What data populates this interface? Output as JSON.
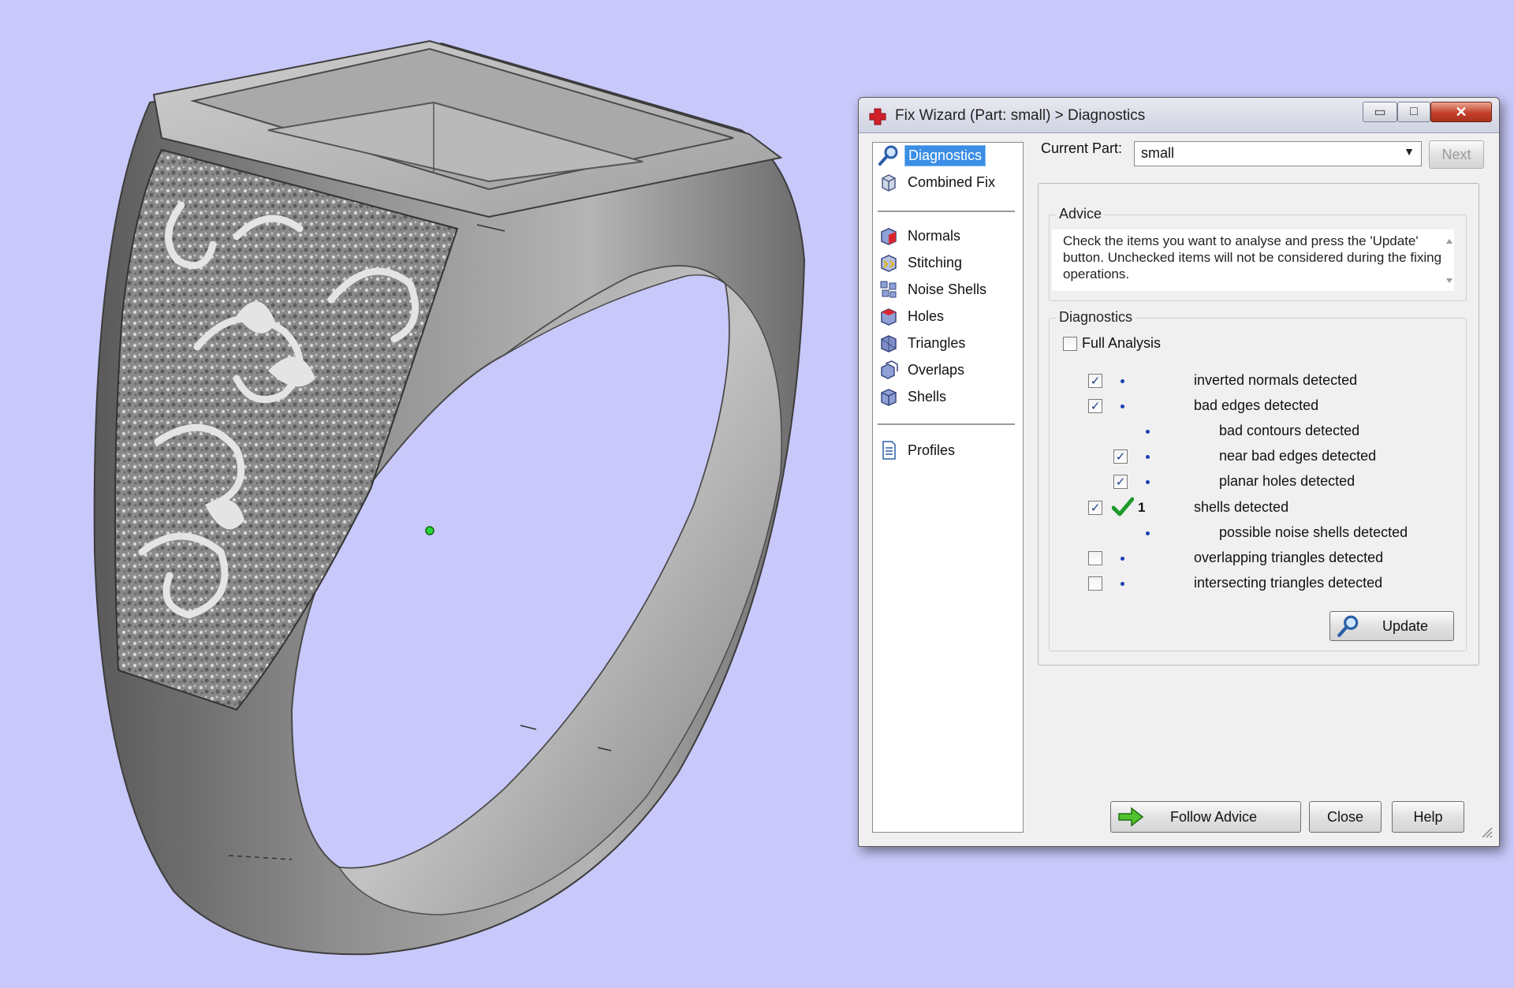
{
  "dialog": {
    "title": "Fix Wizard (Part: small) > Diagnostics",
    "window_buttons": {
      "minimize": "▭",
      "maximize": "□",
      "close": "✕"
    }
  },
  "nav": {
    "items_top": [
      {
        "label": "Diagnostics",
        "icon": "magnifier-icon",
        "selected": true
      },
      {
        "label": "Combined Fix",
        "icon": "cubes-icon"
      }
    ],
    "items_mid": [
      {
        "label": "Normals",
        "icon": "normals-cube-icon"
      },
      {
        "label": "Stitching",
        "icon": "stitching-icon"
      },
      {
        "label": "Noise Shells",
        "icon": "noise-shells-icon"
      },
      {
        "label": "Holes",
        "icon": "holes-cube-icon"
      },
      {
        "label": "Triangles",
        "icon": "triangles-icon"
      },
      {
        "label": "Overlaps",
        "icon": "overlaps-icon"
      },
      {
        "label": "Shells",
        "icon": "shells-icon"
      }
    ],
    "items_bottom": [
      {
        "label": "Profiles",
        "icon": "document-icon"
      }
    ]
  },
  "current_part": {
    "label": "Current Part:",
    "value": "small"
  },
  "buttons": {
    "next": "Next",
    "update": "Update",
    "follow_advice": "Follow Advice",
    "close": "Close",
    "help": "Help"
  },
  "advice": {
    "legend": "Advice",
    "text": "Check the items you want to analyse and press the 'Update' button. Unchecked items will not be considered during the fixing operations."
  },
  "diagnostics": {
    "legend": "Diagnostics",
    "full_analysis": {
      "label": "Full Analysis",
      "checked": false
    },
    "rows": [
      {
        "label": "inverted normals detected",
        "checked": true,
        "status": "•",
        "count": ""
      },
      {
        "label": "bad edges detected",
        "checked": true,
        "status": "•",
        "count": ""
      },
      {
        "label": "bad contours detected",
        "checked": null,
        "status": "•",
        "count": ""
      },
      {
        "label": "near bad edges detected",
        "checked": true,
        "status": "•",
        "count": ""
      },
      {
        "label": "planar holes detected",
        "checked": true,
        "status": "•",
        "count": ""
      },
      {
        "label": "shells detected",
        "checked": true,
        "status": "ok",
        "count": "1"
      },
      {
        "label": "possible noise shells detected",
        "checked": null,
        "status": "•",
        "count": ""
      },
      {
        "label": "overlapping triangles detected",
        "checked": false,
        "status": "•",
        "count": ""
      },
      {
        "label": "intersecting triangles detected",
        "checked": false,
        "status": "•",
        "count": ""
      }
    ]
  },
  "colors": {
    "viewport_bg": "#c8c8fa",
    "selection": "#3a8ee6",
    "close_button": "#c4402a",
    "status_dot": "#1a3fb3",
    "ok_check": "#1d9a2b"
  }
}
